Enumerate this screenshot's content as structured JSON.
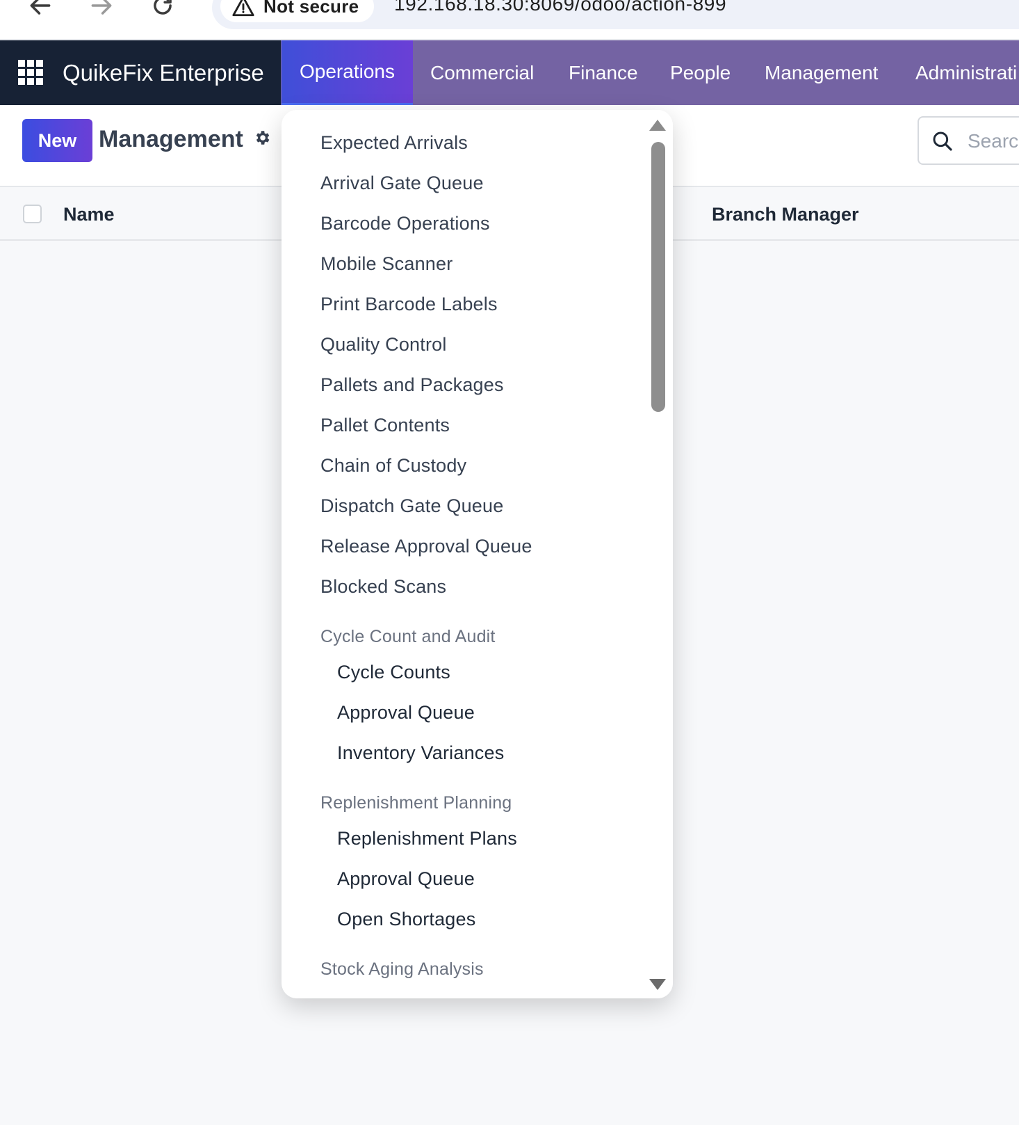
{
  "browser": {
    "security_label": "Not secure",
    "url": "192.168.18.30:8069/odoo/action-899"
  },
  "app": {
    "brand": "QuikeFix Enterprise",
    "menu": [
      {
        "label": "Operations",
        "active": true
      },
      {
        "label": "Commercial"
      },
      {
        "label": "Finance"
      },
      {
        "label": "People"
      },
      {
        "label": "Management"
      },
      {
        "label": "Administrati"
      }
    ]
  },
  "control_panel": {
    "new_label": "New",
    "title": "Management",
    "search_placeholder": "Search..."
  },
  "list": {
    "columns": [
      "Name",
      "Branch Manager"
    ]
  },
  "dropdown": {
    "items": [
      "Expected Arrivals",
      "Arrival Gate Queue",
      "Barcode Operations",
      "Mobile Scanner",
      "Print Barcode Labels",
      "Quality Control",
      "Pallets and Packages",
      "Pallet Contents",
      "Chain of Custody",
      "Dispatch Gate Queue",
      "Release Approval Queue",
      "Blocked Scans"
    ],
    "sections": [
      {
        "title": "Cycle Count and Audit",
        "items": [
          "Cycle Counts",
          "Approval Queue",
          "Inventory Variances"
        ]
      },
      {
        "title": "Replenishment Planning",
        "items": [
          "Replenishment Plans",
          "Approval Queue",
          "Open Shortages"
        ]
      },
      {
        "title": "Stock Aging Analysis",
        "items": []
      }
    ]
  },
  "colors": {
    "nav_bg": "#7463a3",
    "brand_bg": "#172235",
    "accent_start": "#3b4de0",
    "accent_end": "#6b3fd6"
  }
}
